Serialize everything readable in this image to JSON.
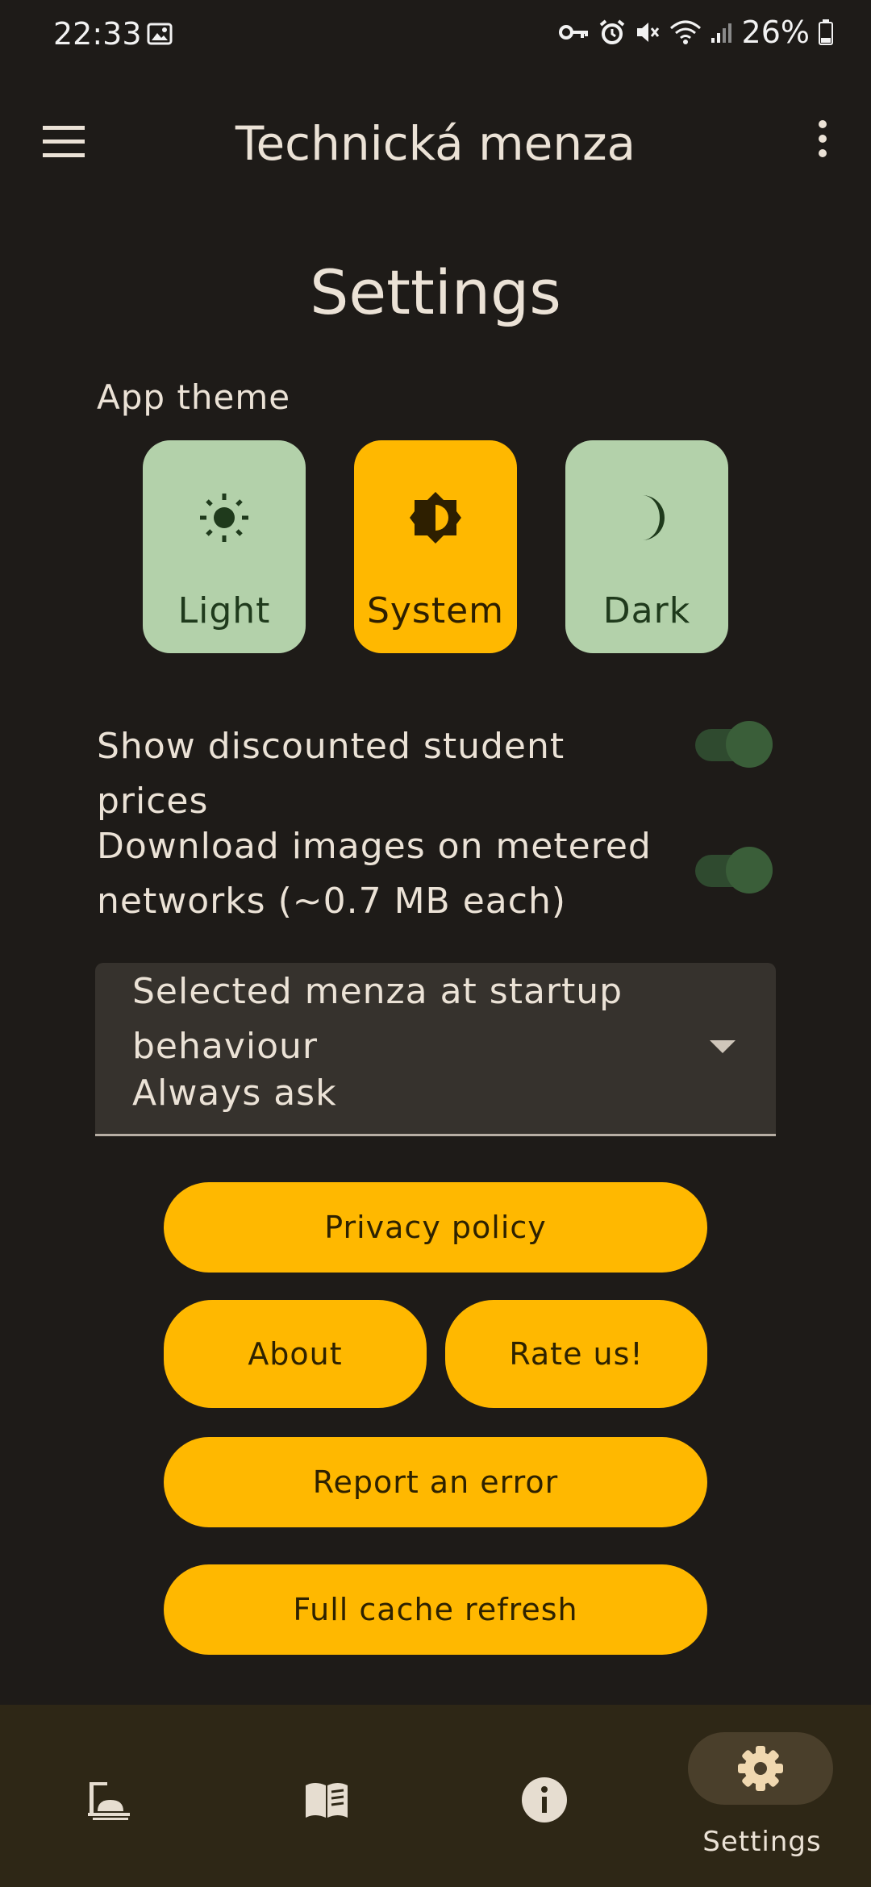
{
  "status_bar": {
    "time": "22:33",
    "battery": "26%",
    "icons": [
      "image-icon",
      "vpn-key-icon",
      "alarm-icon",
      "mute-icon",
      "wifi-icon",
      "signal-icon",
      "battery-icon"
    ]
  },
  "app_bar": {
    "title": "Technická menza",
    "left_icon": "menu-icon",
    "right_icon": "more-vert-icon"
  },
  "page": {
    "title": "Settings"
  },
  "theme": {
    "label": "App theme",
    "options": [
      {
        "label": "Light",
        "icon": "sun-icon",
        "selected": false
      },
      {
        "label": "System",
        "icon": "auto-brightness-icon",
        "selected": true
      },
      {
        "label": "Dark",
        "icon": "moon-icon",
        "selected": false
      }
    ]
  },
  "toggles": [
    {
      "label": "Show discounted student prices",
      "checked": true
    },
    {
      "label": "Download images on metered networks (~0.7 MB each)",
      "checked": true
    }
  ],
  "dropdown": {
    "label": "Selected menza at startup behaviour",
    "value": "Always ask"
  },
  "buttons": {
    "privacy": "Privacy policy",
    "about": "About",
    "rate": "Rate us!",
    "report": "Report an error",
    "cache": "Full cache refresh"
  },
  "bottom_nav": {
    "items": [
      {
        "icon": "food-tray-icon",
        "label": ""
      },
      {
        "icon": "menu-book-icon",
        "label": ""
      },
      {
        "icon": "info-icon",
        "label": ""
      },
      {
        "icon": "gear-icon",
        "label": "Settings",
        "selected": true
      }
    ]
  },
  "colors": {
    "background": "#1e1b18",
    "accent": "#ffb800",
    "theme_card": "#b3d1aa",
    "nav_bar": "#2e2716",
    "switch": "#3a5e39"
  }
}
